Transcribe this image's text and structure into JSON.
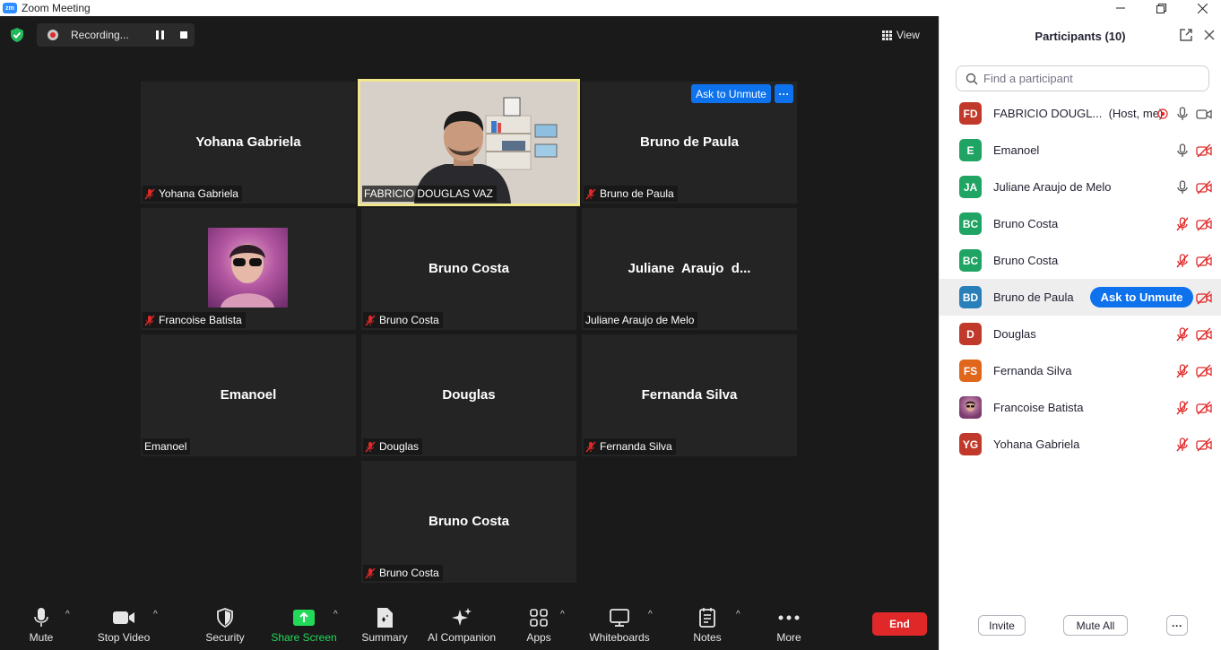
{
  "window": {
    "title": "Zoom Meeting",
    "logo_text": "zm"
  },
  "meeting": {
    "recording_label": "Recording...",
    "view_label": "View",
    "ask_to_unmute_label": "Ask to Unmute",
    "more_dots": "···"
  },
  "tiles": [
    {
      "center_name": "Yohana Gabriela",
      "label": "Yohana Gabriela",
      "muted": true
    },
    {
      "center_name": "",
      "label": "FABRICIO DOUGLAS VAZ",
      "muted": false,
      "speaker": true
    },
    {
      "center_name": "Bruno de Paula",
      "label": "Bruno de Paula",
      "muted": true
    },
    {
      "center_name": "",
      "label": "Francoise Batista",
      "muted": true
    },
    {
      "center_name": "Bruno Costa",
      "label": "Bruno Costa",
      "muted": true
    },
    {
      "center_name": "Juliane  Araujo  d...",
      "label": "Juliane Araujo de Melo",
      "muted": false
    },
    {
      "center_name": "Emanoel",
      "label": "Emanoel",
      "muted": false
    },
    {
      "center_name": "Douglas",
      "label": "Douglas",
      "muted": true
    },
    {
      "center_name": "Fernanda Silva",
      "label": "Fernanda Silva",
      "muted": true
    },
    {
      "center_name": "Bruno Costa",
      "label": "Bruno Costa",
      "muted": true
    }
  ],
  "toolbar": {
    "mute": "Mute",
    "stop_video": "Stop Video",
    "security": "Security",
    "share_screen": "Share Screen",
    "summary": "Summary",
    "ai_companion": "AI Companion",
    "apps": "Apps",
    "whiteboards": "Whiteboards",
    "notes": "Notes",
    "more": "More",
    "end": "End",
    "caret": "^"
  },
  "participants_panel": {
    "title": "Participants (10)",
    "search_placeholder": "Find a participant",
    "ask_to_unmute_label": "Ask to Unmute",
    "invite": "Invite",
    "mute_all": "Mute All",
    "more": "···",
    "participants": [
      {
        "initials": "FD",
        "name": "FABRICIO DOUGL...",
        "suffix": "(Host, me)",
        "color": "#c0392b",
        "mic": "on",
        "video": "on",
        "recording": true
      },
      {
        "initials": "E",
        "name": "Emanoel",
        "suffix": "",
        "color": "#1fa463",
        "mic": "on",
        "video": "off"
      },
      {
        "initials": "JA",
        "name": "Juliane Araujo de Melo",
        "suffix": "",
        "color": "#1fa463",
        "mic": "on",
        "video": "off"
      },
      {
        "initials": "BC",
        "name": "Bruno Costa",
        "suffix": "",
        "color": "#1fa463",
        "mic": "muted",
        "video": "off"
      },
      {
        "initials": "BC",
        "name": "Bruno Costa",
        "suffix": "",
        "color": "#1fa463",
        "mic": "muted",
        "video": "off"
      },
      {
        "initials": "BD",
        "name": "Bruno de Paula",
        "suffix": "",
        "color": "#2980b9",
        "mic": "muted",
        "video": "off",
        "highlighted": true
      },
      {
        "initials": "D",
        "name": "Douglas",
        "suffix": "",
        "color": "#c0392b",
        "mic": "muted",
        "video": "off"
      },
      {
        "initials": "FS",
        "name": "Fernanda Silva",
        "suffix": "",
        "color": "#e0661b",
        "mic": "muted",
        "video": "off"
      },
      {
        "initials": "",
        "name": "Francoise Batista",
        "suffix": "",
        "color": "#7a3b6d",
        "mic": "muted",
        "video": "off",
        "photo": true
      },
      {
        "initials": "YG",
        "name": "Yohana Gabriela",
        "suffix": "",
        "color": "#c0392b",
        "mic": "muted",
        "video": "off"
      }
    ]
  },
  "colors": {
    "accent": "#0e72ed",
    "end": "#e02828",
    "share": "#23d959",
    "speaker_border": "#f0e68c",
    "muted_red": "#e02828"
  }
}
